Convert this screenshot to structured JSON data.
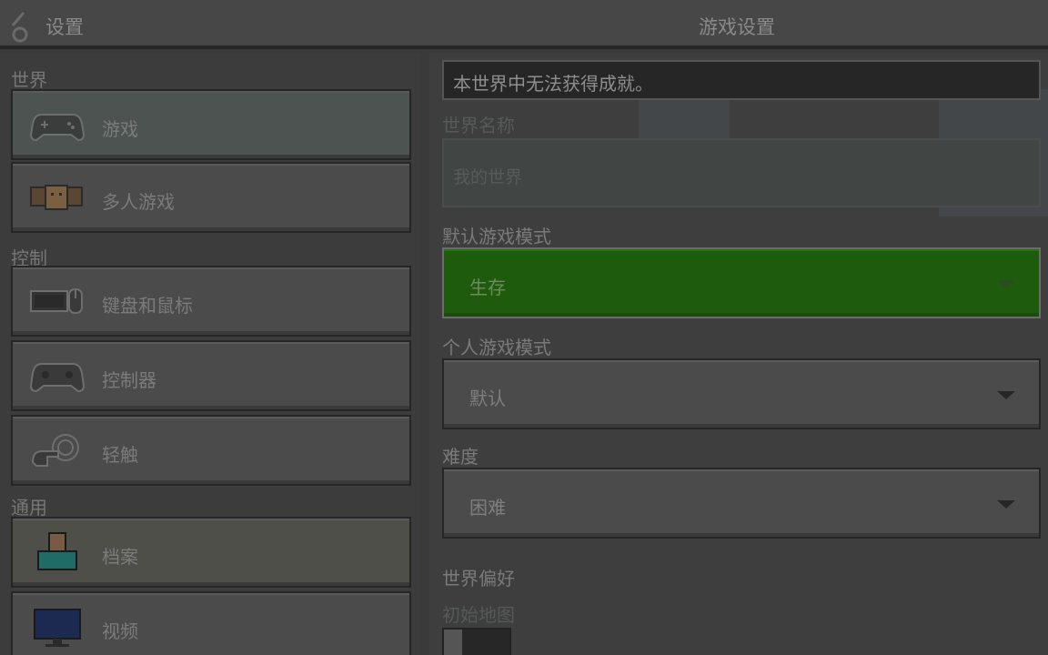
{
  "header": {
    "back_label": "设置",
    "title": "游戏设置"
  },
  "sidebar": {
    "sections": [
      {
        "label": "世界"
      },
      {
        "label": "控制"
      },
      {
        "label": "通用"
      }
    ],
    "items": [
      {
        "label": "游戏",
        "icon": "gamepad-icon"
      },
      {
        "label": "多人游戏",
        "icon": "multiplayer-icon"
      },
      {
        "label": "键盘和鼠标",
        "icon": "keyboard-mouse-icon"
      },
      {
        "label": "控制器",
        "icon": "controller-icon"
      },
      {
        "label": "轻触",
        "icon": "touch-icon"
      },
      {
        "label": "档案",
        "icon": "profile-icon"
      },
      {
        "label": "视频",
        "icon": "monitor-icon"
      }
    ]
  },
  "main": {
    "banner": "本世界中无法获得成就。",
    "world_name_label": "世界名称",
    "world_name_value": "我的世界",
    "default_mode_label": "默认游戏模式",
    "default_mode_value": "生存",
    "personal_mode_label": "个人游戏模式",
    "personal_mode_value": "默认",
    "difficulty_label": "难度",
    "difficulty_value": "困难",
    "preferences_label": "世界偏好",
    "starter_map_label": "初始地图"
  },
  "colors": {
    "active_dropdown": "#1f5b0d",
    "button": "#4b4b4b",
    "header": "#474747"
  }
}
